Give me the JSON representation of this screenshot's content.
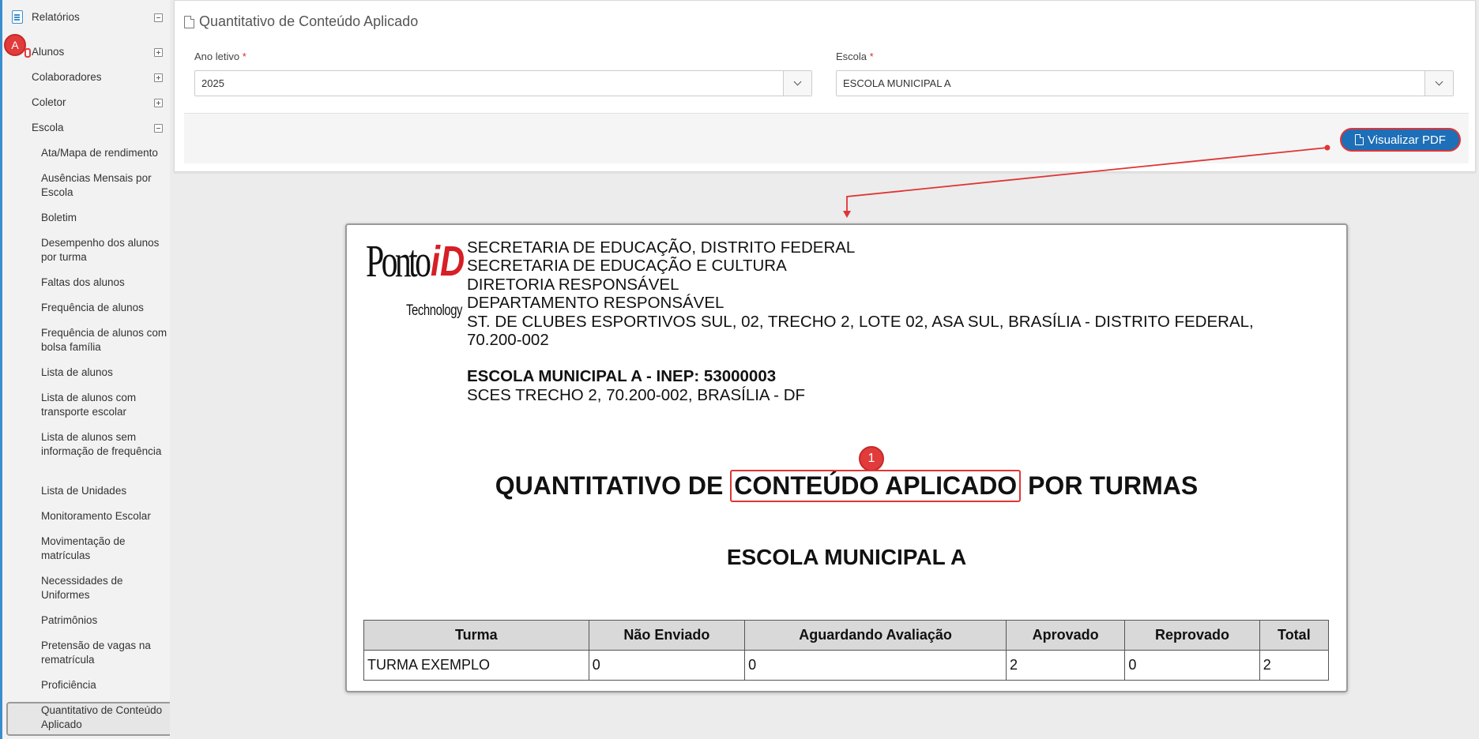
{
  "sidebar": {
    "top_items": [
      {
        "label": "Relatórios"
      },
      {
        "label": "Alunos"
      },
      {
        "label": "Colaboradores"
      },
      {
        "label": "Coletor"
      },
      {
        "label": "Escola"
      }
    ],
    "escola_items": [
      "Ata/Mapa de rendimento",
      "Ausências Mensais por Escola",
      "Boletim",
      "Desempenho dos alunos por turma",
      "Faltas dos alunos",
      "Frequência de alunos",
      "Frequência de alunos com bolsa família",
      "Lista de alunos",
      "Lista de alunos com transporte escolar",
      "Lista de alunos sem informação de frequência",
      "Lista de Unidades",
      "Monitoramento Escolar",
      "Movimentação de matrículas",
      "Necessidades de Uniformes",
      "Patrimônios",
      "Pretensão de vagas na rematrícula",
      "Proficiência",
      "Quantitativo de Conteúdo Aplicado"
    ],
    "marker": "A"
  },
  "panel": {
    "title": "Quantitativo de Conteúdo Aplicado",
    "ano_label": "Ano letivo",
    "ano_value": "2025",
    "escola_label": "Escola",
    "escola_value": "ESCOLA MUNICIPAL A",
    "required_mark": "*",
    "button_label": "Visualizar PDF"
  },
  "report": {
    "header_lines": [
      "SECRETARIA DE EDUCAÇÃO, DISTRITO FEDERAL",
      "SECRETARIA DE EDUCAÇÃO E CULTURA",
      "DIRETORIA RESPONSÁVEL",
      "DEPARTAMENTO RESPONSÁVEL",
      "ST. DE CLUBES ESPORTIVOS SUL, 02,  TRECHO 2, LOTE 02, ASA SUL, BRASÍLIA - DISTRITO FEDERAL,",
      "70.200-002"
    ],
    "school_line": "ESCOLA MUNICIPAL A - INEP: 53000003",
    "school_address": "SCES TRECHO 2, 70.200-002, BRASÍLIA - DF",
    "title_pre": "QUANTITATIVO DE",
    "title_highlight": "CONTEÚDO APLICADO",
    "title_post": "POR TURMAS",
    "marker": "1",
    "subtitle": "ESCOLA MUNICIPAL A",
    "logo_word": "Ponto",
    "logo_id": "iD",
    "logo_tech": "Technology",
    "table": {
      "headers": [
        "Turma",
        "Não Enviado",
        "Aguardando Avaliação",
        "Aprovado",
        "Reprovado",
        "Total"
      ],
      "rows": [
        [
          "TURMA EXEMPLO",
          "0",
          "0",
          "2",
          "0",
          "2"
        ]
      ]
    }
  }
}
